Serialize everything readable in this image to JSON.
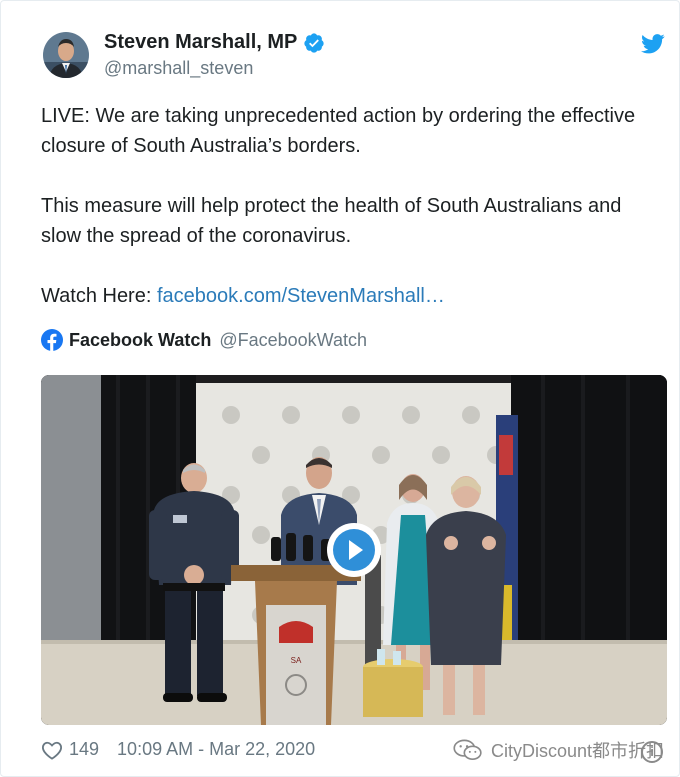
{
  "author": {
    "name": "Steven Marshall, MP",
    "handle": "@marshall_steven"
  },
  "tweet": {
    "paragraph1": "LIVE: We are taking unprecedented action by ordering the effective closure of South Australia’s borders.",
    "paragraph2": "This measure will help protect the health of South Australians and slow the spread of the coronavirus.",
    "watch_prefix": "Watch Here: ",
    "watch_link": "facebook.com/StevenMarshall…"
  },
  "embed": {
    "source_name": "Facebook Watch",
    "source_handle": "@FacebookWatch"
  },
  "footer": {
    "likes": "149",
    "timestamp": "10:09 AM - Mar 22, 2020"
  },
  "watermark": {
    "text": "CityDiscount都市折扣",
    "info_glyph": "i"
  },
  "colors": {
    "link": "#2b7bb9",
    "verified": "#1da1f2",
    "twitter_bird": "#1da1f2",
    "facebook": "#1877f2",
    "play_button": "#2f8fd8"
  },
  "icons": [
    "verified-badge-icon",
    "twitter-bird-icon",
    "facebook-icon",
    "play-icon",
    "heart-icon",
    "wechat-icon",
    "info-icon"
  ]
}
